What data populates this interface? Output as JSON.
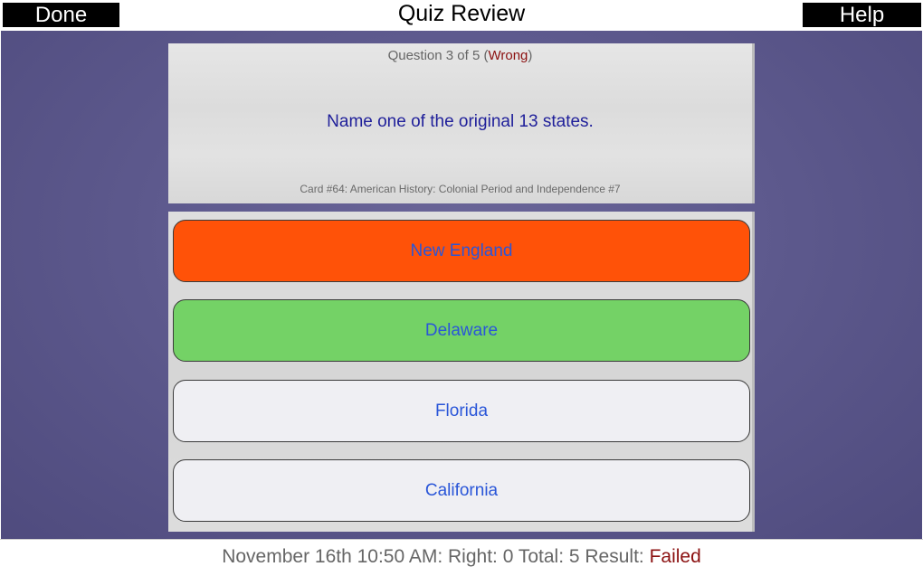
{
  "header": {
    "title": "Quiz Review",
    "done_label": "Done",
    "help_label": "Help"
  },
  "question_card": {
    "counter_text": "Question 3 of 5 (",
    "status": "Wrong",
    "counter_close": ")",
    "question": "Name one of the original 13 states.",
    "card_info": "Card #64: American History: Colonial Period and Independence #7"
  },
  "answers": [
    {
      "label": "New England",
      "state": "wrong"
    },
    {
      "label": "Delaware",
      "state": "correct"
    },
    {
      "label": "Florida",
      "state": "unselected"
    },
    {
      "label": "California",
      "state": "unselected"
    }
  ],
  "footer": {
    "summary": "November 16th 10:50 AM: Right: 0 Total: 5 Result: ",
    "result": "Failed"
  },
  "colors": {
    "wrong": "#ff5208",
    "correct": "#74d266",
    "unselected": "#efeff3",
    "answer_text": "#2a56d8",
    "failed_text": "#8b1010",
    "question_text": "#1f1f9a"
  }
}
